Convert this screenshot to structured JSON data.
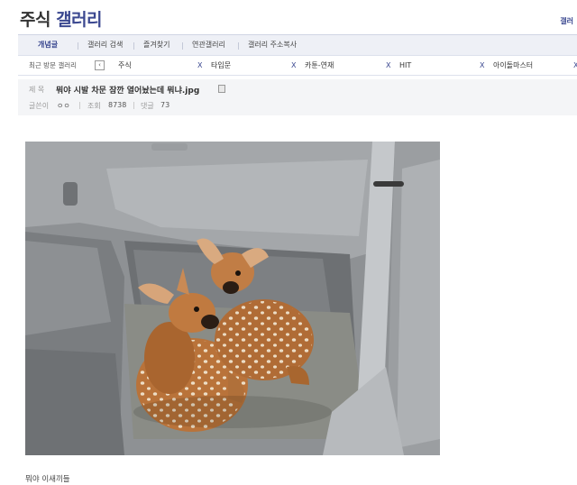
{
  "header": {
    "title_part1": "주식",
    "title_part2": "갤러리",
    "right_link": "갤러"
  },
  "gnb": {
    "items": [
      "개념글",
      "갤러리 검색",
      "즐겨찾기",
      "연관갤러리",
      "갤러리 주소복사"
    ]
  },
  "recent": {
    "label": "최근 방문 갤러리",
    "prev_icon": "chevron-left-icon",
    "items": [
      "주식",
      "타입문",
      "카툰-연재",
      "HIT",
      "아이돌마스터"
    ],
    "remove_symbol": "X"
  },
  "post": {
    "subject_label": "제 목",
    "title": "뭐야 시발 차문 잠깐 열어놨는데 뭐냐.jpg",
    "author_label": "글쓴이",
    "author": "ㅇㅇ",
    "views_label": "조회",
    "views": "8738",
    "comments_label": "댓글",
    "comments": "73",
    "body": "뭐야 이새끼들"
  },
  "colors": {
    "accent": "#3b4890",
    "nav_bg": "#eef0f6",
    "header_bg": "#f4f5f7"
  }
}
